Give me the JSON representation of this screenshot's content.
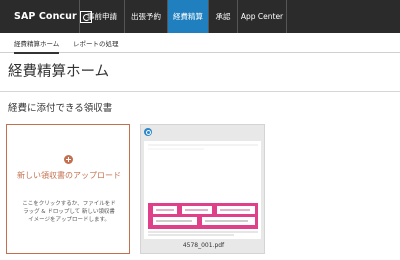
{
  "app": {
    "logo_text": "SAP Concur"
  },
  "nav": {
    "items": [
      {
        "label": "事前申請"
      },
      {
        "label": "出張予約"
      },
      {
        "label": "経費精算"
      },
      {
        "label": "承認"
      },
      {
        "label": "App Center"
      }
    ],
    "active_index": 2
  },
  "subnav": {
    "tabs": [
      {
        "label": "経費精算ホーム"
      },
      {
        "label": "レポートの処理"
      }
    ],
    "active_index": 0
  },
  "page": {
    "title": "経費精算ホーム"
  },
  "receipts_section": {
    "title": "経費に添付できる領収書",
    "upload": {
      "label": "新しい領収書のアップロード",
      "help": "ここをクリックするか、ファイルをドラッグ & ドロップして 新しい領収書イメージをアップロードします。"
    },
    "receipt": {
      "filename": "4578_001.pdf"
    }
  },
  "colors": {
    "nav_bg": "#2b2b2b",
    "nav_active": "#1f7fbf",
    "accent": "#c4704f",
    "zoom_icon": "#2d86c8",
    "receipt_pink": "#e0408a"
  }
}
